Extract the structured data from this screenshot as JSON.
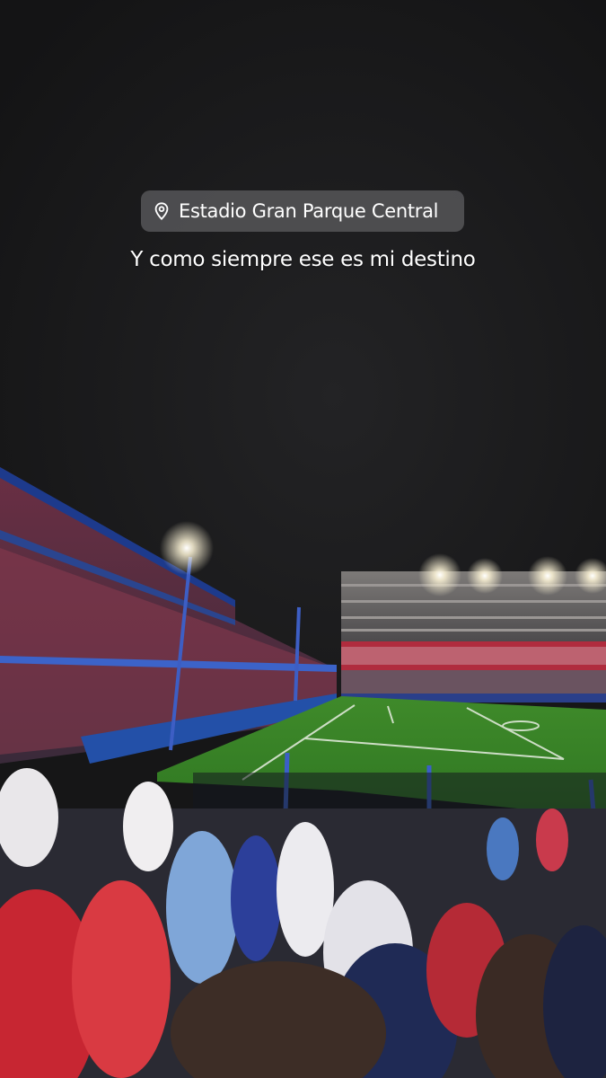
{
  "story": {
    "location_sticker": {
      "icon": "location-pin-icon",
      "label": "Estadio Gran Parque Central"
    },
    "caption": "Y como siempre ese es mi destino"
  },
  "photo": {
    "scene": "night-football-stadium",
    "colors": {
      "sky": "#151516",
      "pitch": "#3f8f2a",
      "crowd_red": "#c8283a",
      "crowd_blue": "#3b5db8",
      "floodlight": "#fff9e6"
    }
  }
}
